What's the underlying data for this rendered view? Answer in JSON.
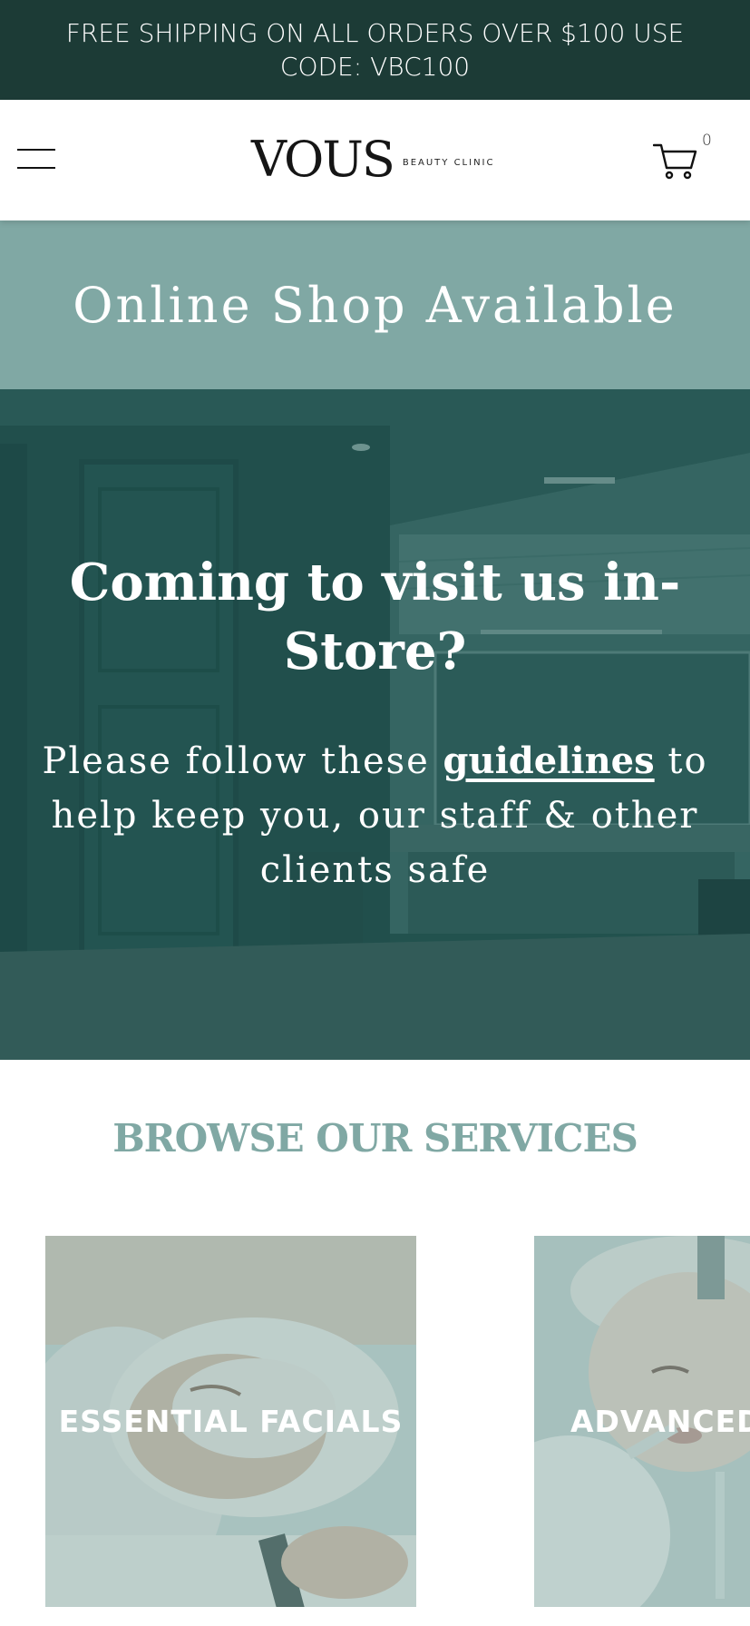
{
  "announcement": {
    "text": "FREE SHIPPING ON ALL ORDERS OVER $100 USE CODE: VBC100"
  },
  "header": {
    "menu_icon": "hamburger-menu-icon",
    "logo_main": "VOUS",
    "logo_sub": "BEAUTY CLINIC",
    "cart_icon": "shopping-cart-icon",
    "cart_count": "0"
  },
  "online_banner": {
    "title": "Online Shop Available"
  },
  "hero": {
    "title": "Coming to visit us in-Store?",
    "text_before": "Please follow these ",
    "link_text": "guidelines",
    "text_after": " to help keep you, our staff & other clients safe"
  },
  "services": {
    "title": "BROWSE OUR SERVICES",
    "cards": [
      {
        "label": "ESSENTIAL FACIALS"
      },
      {
        "label": "ADVANCED FACIALS"
      }
    ]
  },
  "colors": {
    "announcement_bg": "#1c3b36",
    "accent": "#80a8a4",
    "hero_overlay": "#174a48"
  }
}
